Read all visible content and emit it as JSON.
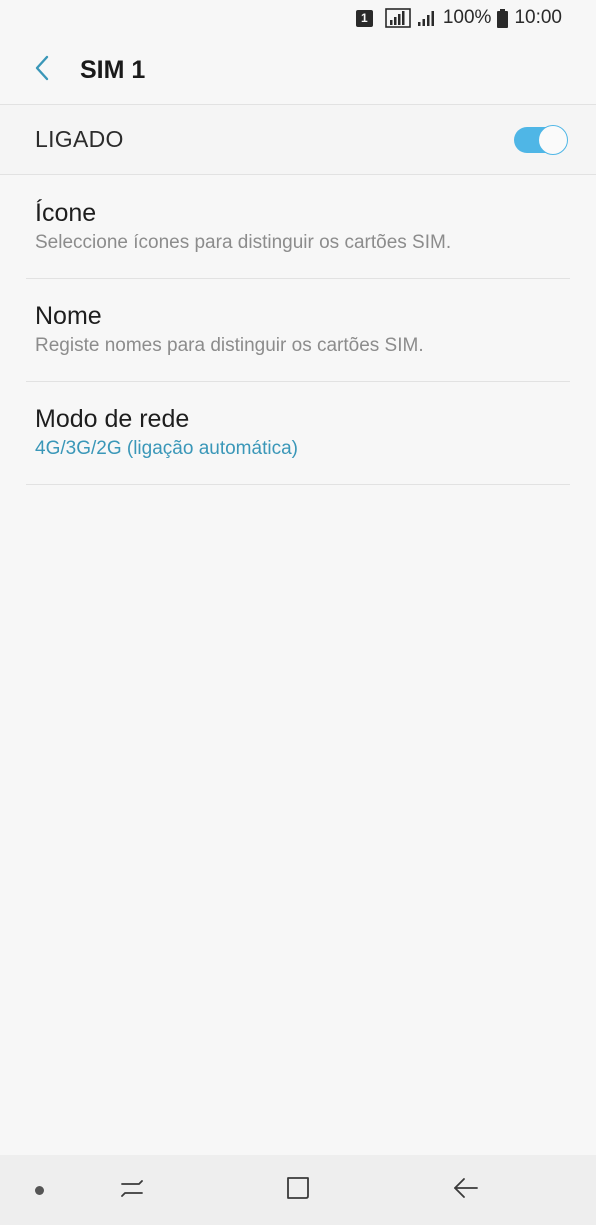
{
  "status_bar": {
    "sim_indicator": "1",
    "battery_text": "100%",
    "time": "10:00",
    "icons": [
      "sim-1-icon",
      "signal-icon",
      "signal-icon",
      "battery-icon"
    ]
  },
  "app_bar": {
    "title": "SIM 1",
    "back_icon": "chevron-left-icon"
  },
  "master_switch": {
    "label": "LIGADO",
    "state": "on",
    "accent_color": "#4fb6e6"
  },
  "settings": {
    "items": [
      {
        "title": "Ícone",
        "subtitle": "Seleccione ícones para distinguir os cartões SIM."
      },
      {
        "title": "Nome",
        "subtitle": "Registe nomes para distinguir os cartões SIM."
      },
      {
        "title": "Modo de rede",
        "subtitle": "4G/3G/2G (ligação automática)",
        "subtitle_color": "#3a97b8"
      }
    ]
  },
  "nav_bar": {
    "icons": [
      "dot-icon",
      "recent-apps-icon",
      "home-icon",
      "back-arrow-icon"
    ]
  }
}
